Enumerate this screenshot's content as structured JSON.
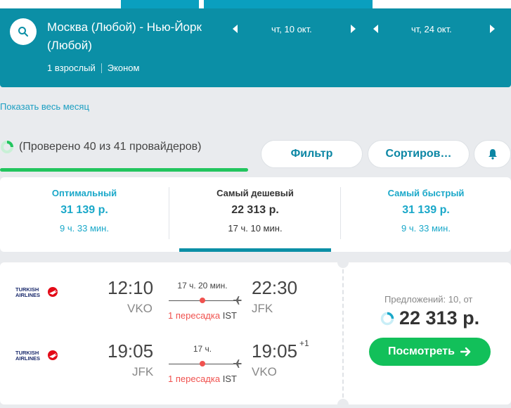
{
  "header": {
    "route": "Москва (Любой) - Нью-Йорк (Любой)",
    "passengers": "1 взрослый",
    "cabin": "Эконом",
    "date_out": "чт, 10 окт.",
    "date_back": "чт, 24 окт."
  },
  "month_link": "Показать весь месяц",
  "progress": {
    "text": "(Проверено 40 из 41 провайдеров)",
    "checked": 40,
    "total": 41
  },
  "buttons": {
    "filter": "Фильтр",
    "sort": "Сортиров…"
  },
  "tabs": [
    {
      "title": "Оптимальный",
      "price": "31 139 р.",
      "duration": "9 ч. 33 мин."
    },
    {
      "title": "Самый дешевый",
      "price": "22 313 р.",
      "duration": "17 ч. 10 мин."
    },
    {
      "title": "Самый быстрый",
      "price": "31 139 р.",
      "duration": "9 ч. 33 мин."
    }
  ],
  "ticket": {
    "airline_logo_text": "TURKISH AIRLINES",
    "legs": [
      {
        "dep_time": "12:10",
        "dep_code": "VKO",
        "duration": "17 ч. 20 мин.",
        "arr_time": "22:30",
        "arr_code": "JFK",
        "transfer": "1 пересадка",
        "via": "IST",
        "day_offset": ""
      },
      {
        "dep_time": "19:05",
        "dep_code": "JFK",
        "duration": "17 ч.",
        "arr_time": "19:05",
        "arr_code": "VKO",
        "transfer": "1 пересадка",
        "via": "IST",
        "day_offset": "+1"
      }
    ],
    "offers": "Предложений: 10, от",
    "price": "22 313 р.",
    "view_button": "Посмотреть"
  },
  "colors": {
    "header_bg": "#0b8fa6",
    "accent_teal": "#1aa8c9",
    "green": "#12c05a",
    "red": "#f0524f"
  },
  "icons": [
    "search-icon",
    "chevron-left-icon",
    "chevron-right-icon",
    "spinner-icon",
    "bell-icon",
    "airline-logo",
    "plane-icon",
    "arrow-right-icon"
  ]
}
